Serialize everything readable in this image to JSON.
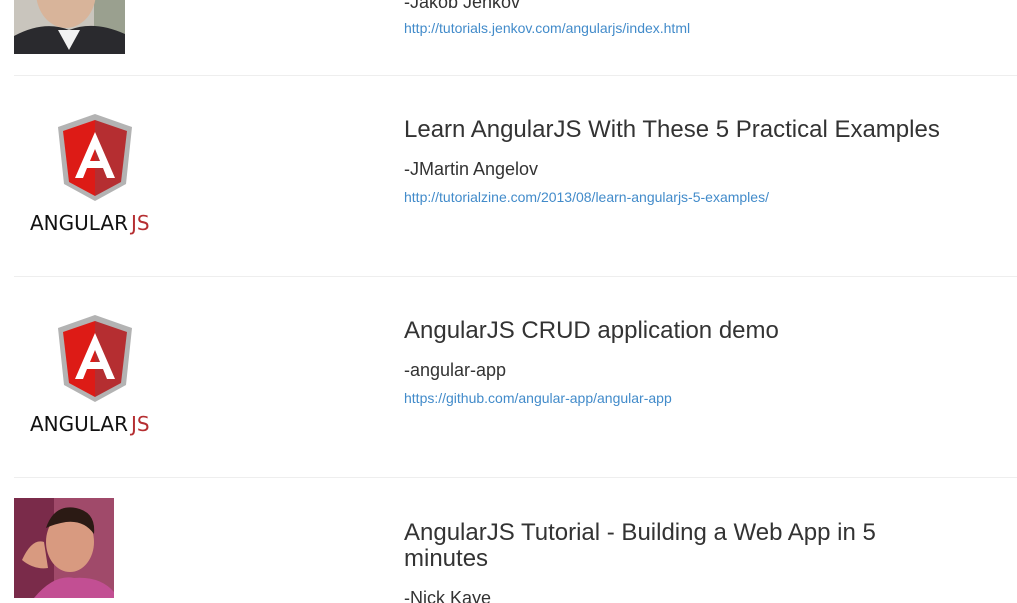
{
  "entries": [
    {
      "author": "-Jakob Jenkov",
      "url": "http://tutorials.jenkov.com/angularjs/index.html",
      "thumb_icon": "person-photo-icon"
    },
    {
      "title": "Learn AngularJS With These 5 Practical Examples",
      "author": "-JMartin Angelov",
      "url": "http://tutorialzine.com/2013/08/learn-angularjs-5-examples/",
      "thumb_icon": "angularjs-logo-icon",
      "logo_text_a": "ANGULAR",
      "logo_text_b": "JS"
    },
    {
      "title": "AngularJS CRUD application demo",
      "author": "-angular-app",
      "url": "https://github.com/angular-app/angular-app",
      "thumb_icon": "angularjs-logo-icon",
      "logo_text_a": "ANGULAR",
      "logo_text_b": "JS"
    },
    {
      "title": "AngularJS Tutorial - Building a Web App in 5 minutes",
      "author": "-Nick Kaye",
      "thumb_icon": "person-photo-icon"
    }
  ],
  "colors": {
    "link": "#428bca",
    "text": "#333333",
    "divider": "#eeeeee",
    "angular_red": "#dd1b16",
    "angular_dark_red": "#b52e31"
  }
}
